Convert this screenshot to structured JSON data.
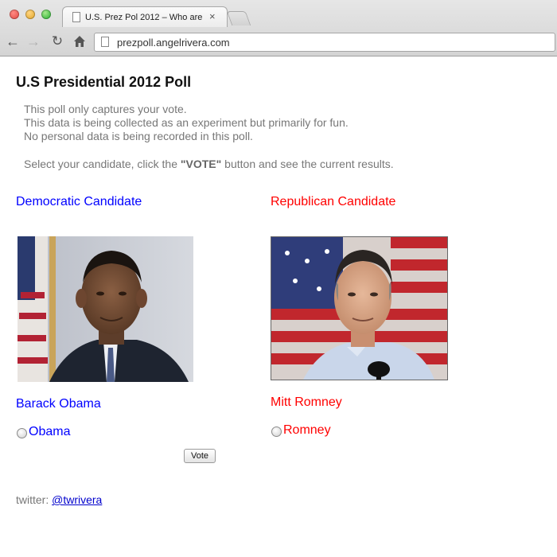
{
  "browser": {
    "tab_title": "U.S. Prez Pol 2012 – Who are",
    "tab_close": "×",
    "url": "prezpoll.angelrivera.com",
    "icons": [
      "back-arrow-icon",
      "forward-arrow-icon",
      "reload-icon",
      "home-icon",
      "page-icon",
      "close-icon",
      "new-tab-icon"
    ]
  },
  "page": {
    "title": "U.S Presidential 2012 Poll",
    "intro_lines": [
      "This poll only captures your vote.",
      "This data is being collected as an experiment but primarily for fun.",
      "No personal data is being recorded in this poll."
    ],
    "instruction": {
      "before": "Select your candidate, click the ",
      "emphasis": "\"VOTE\"",
      "after": " button and see the current results."
    },
    "democratic": {
      "heading": "Democratic Candidate",
      "name": "Barack Obama",
      "radio_label": "Obama",
      "color": "#0000ff"
    },
    "republican": {
      "heading": "Republican Candidate",
      "name": "Mitt Romney",
      "radio_label": "Romney",
      "color": "#ff0000"
    },
    "vote_button": "Vote",
    "twitter_label": "twitter: ",
    "twitter_handle": "@twrivera"
  }
}
